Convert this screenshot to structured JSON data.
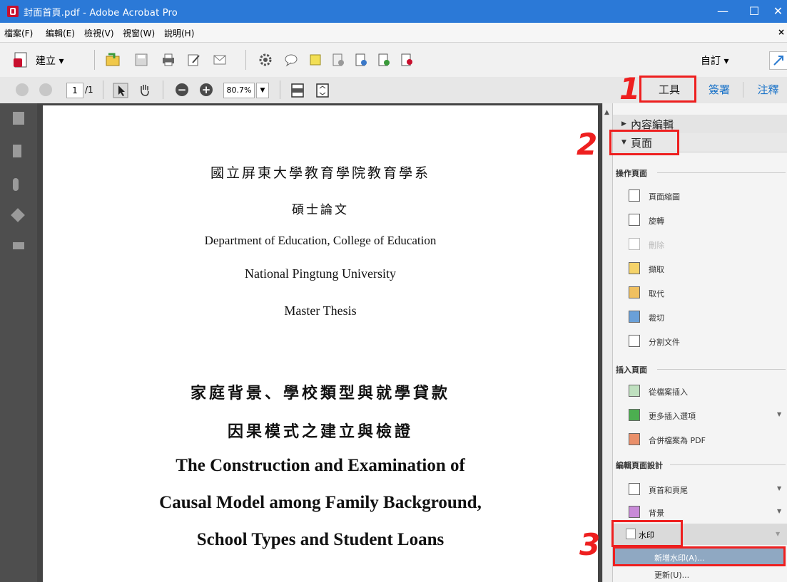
{
  "titlebar": {
    "title": "封面首頁.pdf - Adobe Acrobat Pro",
    "minimize": "—",
    "maximize": "☐",
    "close": "✕"
  },
  "menu": {
    "items": [
      "檔案(F)",
      "編輯(E)",
      "檢視(V)",
      "視窗(W)",
      "說明(H)"
    ],
    "close": "×"
  },
  "toolbar": {
    "create_label": "建立 ▾",
    "customize_label": "自訂 ▾"
  },
  "nav": {
    "page_current": "1",
    "page_total": "/1",
    "zoom": "80.7%"
  },
  "tabs": {
    "tools": "工具",
    "sign": "簽署",
    "comment": "注釋"
  },
  "document": {
    "lines": [
      "國立屏東大學教育學院教育學系",
      "碩士論文",
      "Department of Education, College of Education",
      "National Pingtung University",
      "Master Thesis",
      "家庭背景、學校類型與就學貸款",
      "因果模式之建立與檢證",
      "The Construction and Examination of",
      "Causal Model among Family Background,",
      "School Types and Student Loans"
    ]
  },
  "pane": {
    "header_content": "內容編輯",
    "header_pages": "頁面",
    "section_manipulate": "操作頁面",
    "manipulate_items": [
      "頁面縮圖",
      "旋轉",
      "刪除",
      "擷取",
      "取代",
      "裁切",
      "分割文件"
    ],
    "section_insert": "插入頁面",
    "insert_items": [
      "從檔案插入",
      "更多插入選項",
      "合併檔案為 PDF"
    ],
    "section_design": "編輯頁面設計",
    "design_items": [
      "頁首和頁尾",
      "背景",
      "水印"
    ],
    "watermark_sub": [
      "新增水印(A)...",
      "更新(U)..."
    ]
  },
  "annotations": {
    "n1": "1",
    "n2": "2",
    "n3": "3",
    "accent": "#ee1f1f"
  }
}
